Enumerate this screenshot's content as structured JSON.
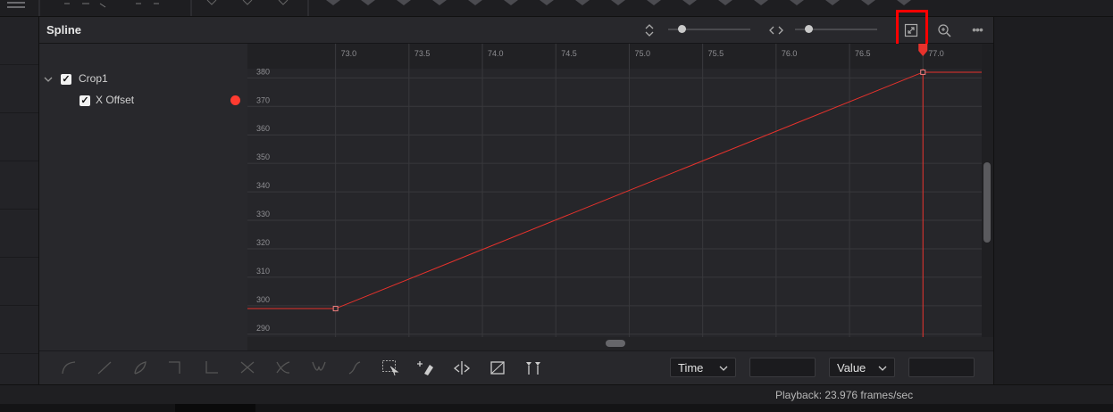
{
  "panel": {
    "title": "Spline"
  },
  "tree": {
    "node": {
      "label": "Crop1",
      "checked": true
    },
    "param": {
      "label": "X Offset",
      "checked": true,
      "color": "#ff3b30"
    }
  },
  "ruler": {
    "time_ticks": [
      "73.0",
      "73.5",
      "74.0",
      "74.5",
      "75.0",
      "75.5",
      "76.0",
      "76.5",
      "77.0"
    ]
  },
  "axis": {
    "value_ticks": [
      "380",
      "370",
      "360",
      "350",
      "340",
      "330",
      "320",
      "310",
      "300",
      "290"
    ]
  },
  "chart_data": {
    "type": "line",
    "xlim": [
      72.4,
      77.4
    ],
    "ylim": [
      289,
      392
    ],
    "series": [
      {
        "x": [
          72.4,
          73.0,
          77.0,
          77.4
        ],
        "y": [
          299,
          299,
          382,
          382
        ],
        "color": "#e8322c"
      }
    ],
    "keyframes": [
      {
        "x": 73.0,
        "y": 299
      },
      {
        "x": 77.0,
        "y": 382
      }
    ],
    "playhead": 77.0,
    "grid": true
  },
  "toolbar": {
    "time_combo": "Time",
    "value_combo": "Value",
    "time_value": "",
    "value_value": ""
  },
  "status": {
    "playback": "Playback: 23.976 frames/sec"
  },
  "colors": {
    "accent": "#e8322c",
    "highlight_box": "#ff0000",
    "background": "#26262a"
  },
  "icons": [
    "more-dots-icon",
    "vertical-zoom-icon",
    "horizontal-zoom-icon",
    "fit-to-window-icon",
    "zoom-in-icon"
  ]
}
